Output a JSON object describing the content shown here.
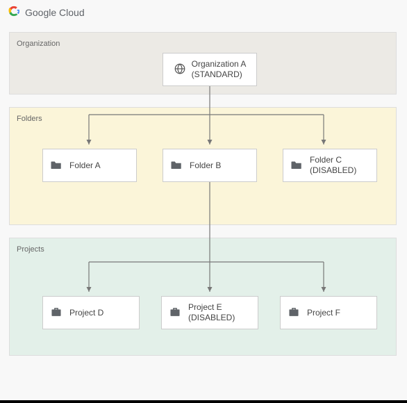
{
  "brand": {
    "strong": "Google",
    "light": "Cloud"
  },
  "panels": {
    "org_label": "Organization",
    "folders_label": "Folders",
    "projects_label": "Projects"
  },
  "org": {
    "name": "Organization A",
    "status": "(STANDARD)"
  },
  "folders": [
    {
      "name": "Folder A",
      "status": ""
    },
    {
      "name": "Folder B",
      "status": ""
    },
    {
      "name": "Folder C",
      "status": "(DISABLED)"
    }
  ],
  "projects": [
    {
      "name": "Project D",
      "status": ""
    },
    {
      "name": "Project E",
      "status": "(DISABLED)"
    },
    {
      "name": "Project F",
      "status": ""
    }
  ],
  "icons": {
    "globe": "globe-icon",
    "folder": "folder-icon",
    "briefcase": "briefcase-icon"
  }
}
